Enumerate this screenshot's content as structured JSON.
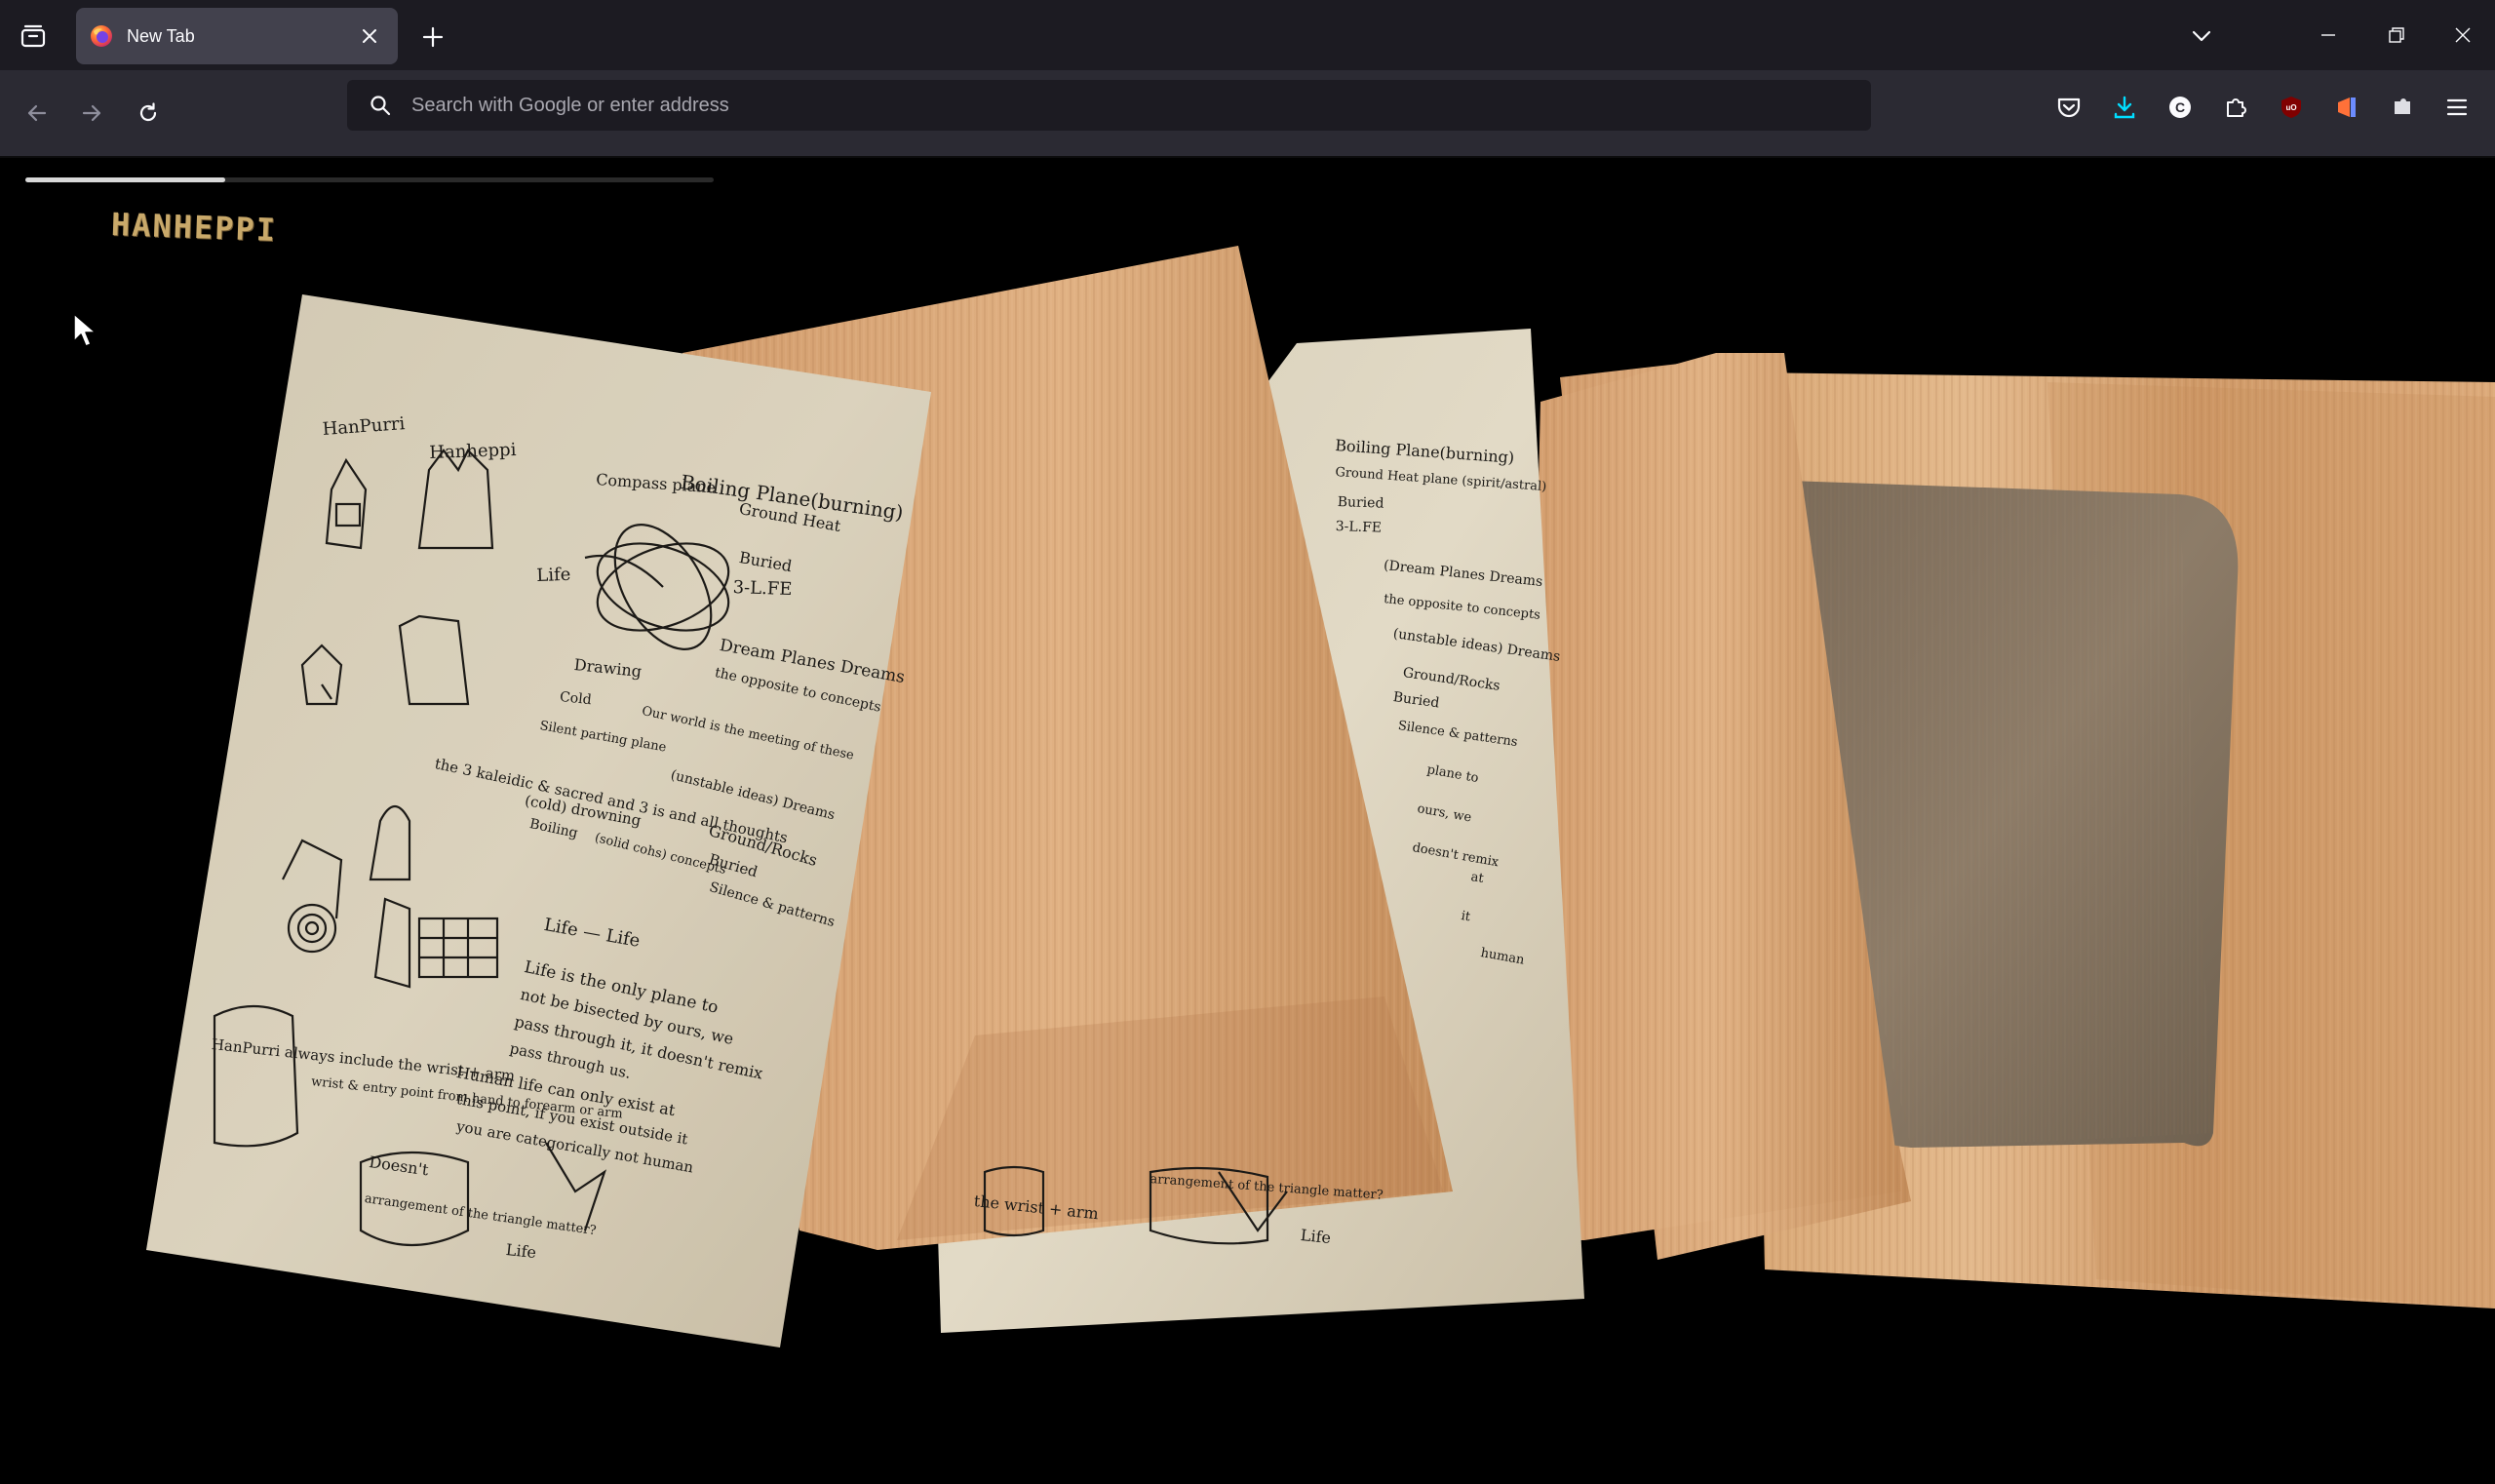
{
  "browser": {
    "tab": {
      "title": "New Tab"
    },
    "urlbar": {
      "placeholder": "Search with Google or enter address"
    },
    "icons": {
      "tab_overview": "list-all-tabs-icon",
      "new_tab": "plus-icon",
      "tab_dropdown": "chevron-down-icon",
      "back": "arrow-left-icon",
      "forward": "arrow-right-icon",
      "reload": "reload-icon",
      "pocket": "pocket-icon",
      "downloads": "download-icon",
      "extensions": "puzzle-icon",
      "menu": "hamburger-menu-icon"
    },
    "accent": "#00ddff"
  },
  "page": {
    "logo_text": "HANHEPPI",
    "progress": 0.29,
    "notes_left": [
      "HanPurri",
      "Hanheppi",
      "Boiling Plane(burning)",
      "Compass plane",
      "Ground Heat",
      "Buried",
      "3-L.FE",
      "Life",
      "Dream Planes Dreams",
      "the opposite to concepts",
      "Drawing",
      "Cold",
      "Our world is the meeting of these",
      "Silent parting plane",
      "the 3 kaleidic & sacred and 3 is and all thoughts",
      "(cold) drowning",
      "Boiling",
      "(solid cohs) concepts",
      "(unstable ideas) Dreams",
      "Ground/Rocks",
      "Buried",
      "Silence & patterns",
      "Life — Life",
      "Life is the only plane to",
      "not be bisected by ours, we",
      "pass through it, it doesn't remix",
      "pass through us.",
      "Human life can only exist at",
      "this point, if you exist outside it",
      "you are categorically not human",
      "HanPurri always include the wrist + arm",
      "wrist & entry point from hand to forearm or arm",
      "Doesn't",
      "arrangement of the triangle matter?",
      "Life"
    ],
    "notes_right": [
      "Boiling Plane(burning)",
      "Ground Heat plane (spirit/astral)",
      "Buried",
      "3-L.FE",
      "(Dream Planes Dreams",
      "the opposite to concepts",
      "(unstable ideas) Dreams",
      "Ground/Rocks",
      "Buried",
      "Silence & patterns",
      "plane to",
      "ours, we",
      "doesn't remix",
      "at",
      "it",
      "human",
      "the wrist + arm",
      "arrangement of the triangle matter?",
      "Life"
    ]
  }
}
